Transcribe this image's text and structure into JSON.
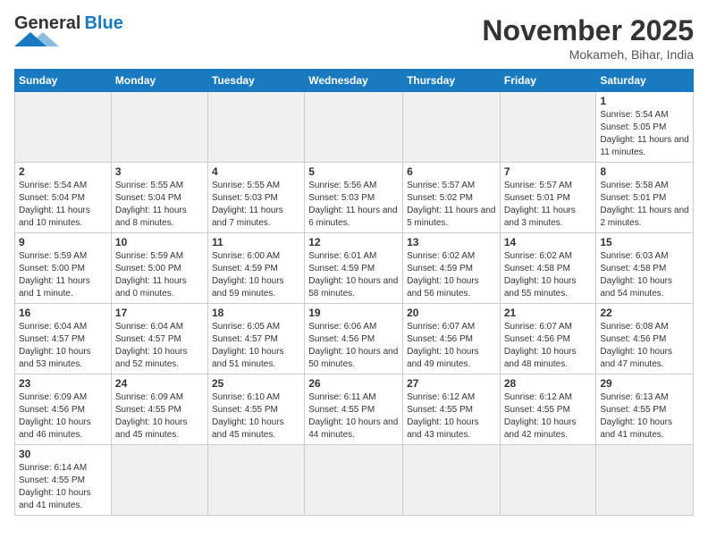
{
  "header": {
    "logo_general": "General",
    "logo_blue": "Blue",
    "month_title": "November 2025",
    "location": "Mokameh, Bihar, India"
  },
  "days_of_week": [
    "Sunday",
    "Monday",
    "Tuesday",
    "Wednesday",
    "Thursday",
    "Friday",
    "Saturday"
  ],
  "weeks": [
    [
      {
        "day": "",
        "info": ""
      },
      {
        "day": "",
        "info": ""
      },
      {
        "day": "",
        "info": ""
      },
      {
        "day": "",
        "info": ""
      },
      {
        "day": "",
        "info": ""
      },
      {
        "day": "",
        "info": ""
      },
      {
        "day": "1",
        "info": "Sunrise: 5:54 AM\nSunset: 5:05 PM\nDaylight: 11 hours and 11 minutes."
      }
    ],
    [
      {
        "day": "2",
        "info": "Sunrise: 5:54 AM\nSunset: 5:04 PM\nDaylight: 11 hours and 10 minutes."
      },
      {
        "day": "3",
        "info": "Sunrise: 5:55 AM\nSunset: 5:04 PM\nDaylight: 11 hours and 8 minutes."
      },
      {
        "day": "4",
        "info": "Sunrise: 5:55 AM\nSunset: 5:03 PM\nDaylight: 11 hours and 7 minutes."
      },
      {
        "day": "5",
        "info": "Sunrise: 5:56 AM\nSunset: 5:03 PM\nDaylight: 11 hours and 6 minutes."
      },
      {
        "day": "6",
        "info": "Sunrise: 5:57 AM\nSunset: 5:02 PM\nDaylight: 11 hours and 5 minutes."
      },
      {
        "day": "7",
        "info": "Sunrise: 5:57 AM\nSunset: 5:01 PM\nDaylight: 11 hours and 3 minutes."
      },
      {
        "day": "8",
        "info": "Sunrise: 5:58 AM\nSunset: 5:01 PM\nDaylight: 11 hours and 2 minutes."
      }
    ],
    [
      {
        "day": "9",
        "info": "Sunrise: 5:59 AM\nSunset: 5:00 PM\nDaylight: 11 hours and 1 minute."
      },
      {
        "day": "10",
        "info": "Sunrise: 5:59 AM\nSunset: 5:00 PM\nDaylight: 11 hours and 0 minutes."
      },
      {
        "day": "11",
        "info": "Sunrise: 6:00 AM\nSunset: 4:59 PM\nDaylight: 10 hours and 59 minutes."
      },
      {
        "day": "12",
        "info": "Sunrise: 6:01 AM\nSunset: 4:59 PM\nDaylight: 10 hours and 58 minutes."
      },
      {
        "day": "13",
        "info": "Sunrise: 6:02 AM\nSunset: 4:59 PM\nDaylight: 10 hours and 56 minutes."
      },
      {
        "day": "14",
        "info": "Sunrise: 6:02 AM\nSunset: 4:58 PM\nDaylight: 10 hours and 55 minutes."
      },
      {
        "day": "15",
        "info": "Sunrise: 6:03 AM\nSunset: 4:58 PM\nDaylight: 10 hours and 54 minutes."
      }
    ],
    [
      {
        "day": "16",
        "info": "Sunrise: 6:04 AM\nSunset: 4:57 PM\nDaylight: 10 hours and 53 minutes."
      },
      {
        "day": "17",
        "info": "Sunrise: 6:04 AM\nSunset: 4:57 PM\nDaylight: 10 hours and 52 minutes."
      },
      {
        "day": "18",
        "info": "Sunrise: 6:05 AM\nSunset: 4:57 PM\nDaylight: 10 hours and 51 minutes."
      },
      {
        "day": "19",
        "info": "Sunrise: 6:06 AM\nSunset: 4:56 PM\nDaylight: 10 hours and 50 minutes."
      },
      {
        "day": "20",
        "info": "Sunrise: 6:07 AM\nSunset: 4:56 PM\nDaylight: 10 hours and 49 minutes."
      },
      {
        "day": "21",
        "info": "Sunrise: 6:07 AM\nSunset: 4:56 PM\nDaylight: 10 hours and 48 minutes."
      },
      {
        "day": "22",
        "info": "Sunrise: 6:08 AM\nSunset: 4:56 PM\nDaylight: 10 hours and 47 minutes."
      }
    ],
    [
      {
        "day": "23",
        "info": "Sunrise: 6:09 AM\nSunset: 4:56 PM\nDaylight: 10 hours and 46 minutes."
      },
      {
        "day": "24",
        "info": "Sunrise: 6:09 AM\nSunset: 4:55 PM\nDaylight: 10 hours and 45 minutes."
      },
      {
        "day": "25",
        "info": "Sunrise: 6:10 AM\nSunset: 4:55 PM\nDaylight: 10 hours and 45 minutes."
      },
      {
        "day": "26",
        "info": "Sunrise: 6:11 AM\nSunset: 4:55 PM\nDaylight: 10 hours and 44 minutes."
      },
      {
        "day": "27",
        "info": "Sunrise: 6:12 AM\nSunset: 4:55 PM\nDaylight: 10 hours and 43 minutes."
      },
      {
        "day": "28",
        "info": "Sunrise: 6:12 AM\nSunset: 4:55 PM\nDaylight: 10 hours and 42 minutes."
      },
      {
        "day": "29",
        "info": "Sunrise: 6:13 AM\nSunset: 4:55 PM\nDaylight: 10 hours and 41 minutes."
      }
    ],
    [
      {
        "day": "30",
        "info": "Sunrise: 6:14 AM\nSunset: 4:55 PM\nDaylight: 10 hours and 41 minutes."
      },
      {
        "day": "",
        "info": ""
      },
      {
        "day": "",
        "info": ""
      },
      {
        "day": "",
        "info": ""
      },
      {
        "day": "",
        "info": ""
      },
      {
        "day": "",
        "info": ""
      },
      {
        "day": "",
        "info": ""
      }
    ]
  ]
}
